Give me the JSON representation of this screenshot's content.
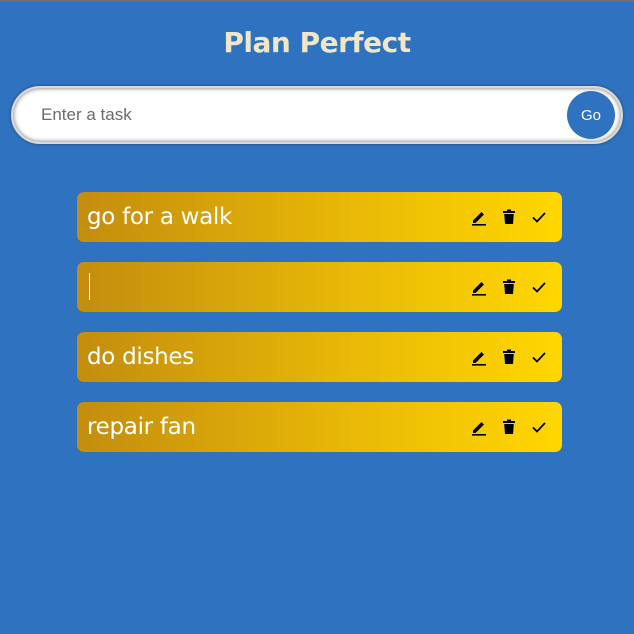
{
  "app": {
    "title": "Plan Perfect"
  },
  "form": {
    "placeholder": "Enter a task",
    "value": "",
    "go_label": "Go"
  },
  "tasks": [
    {
      "text": "go for a walk",
      "editing": false
    },
    {
      "text": "",
      "editing": true
    },
    {
      "text": "do dishes",
      "editing": false
    },
    {
      "text": "repair fan",
      "editing": false
    }
  ],
  "icons": {
    "edit": "pencil-icon",
    "delete": "trash-icon",
    "done": "check-icon"
  },
  "colors": {
    "background": "#2f72c0",
    "title": "#f2e6c9",
    "task_gradient_start": "#c38d0e",
    "task_gradient_end": "#ffd700",
    "go_button": "#2f72c0"
  }
}
